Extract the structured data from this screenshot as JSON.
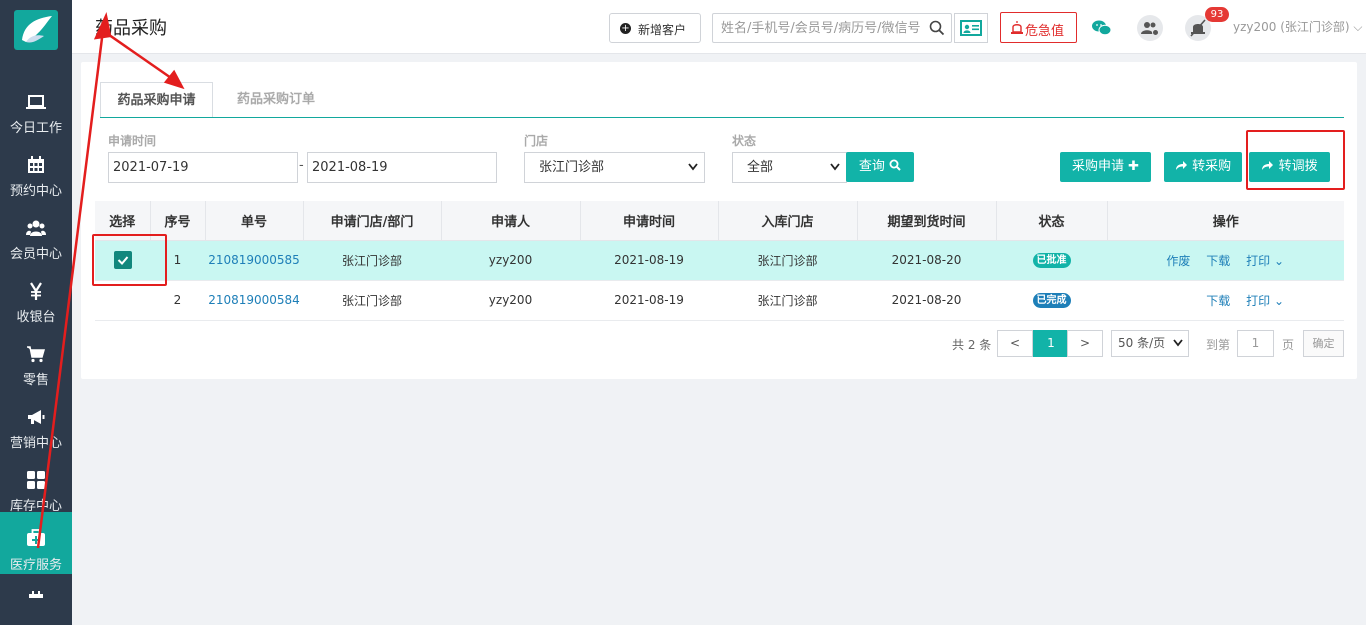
{
  "sidebar": {
    "items": [
      {
        "label": "今日工作",
        "icon": "laptop-icon"
      },
      {
        "label": "预约中心",
        "icon": "calendar-icon"
      },
      {
        "label": "会员中心",
        "icon": "users-icon"
      },
      {
        "label": "收银台",
        "icon": "yen-icon"
      },
      {
        "label": "零售",
        "icon": "cart-icon"
      },
      {
        "label": "营销中心",
        "icon": "megaphone-icon"
      },
      {
        "label": "库存中心",
        "icon": "grid-icon"
      },
      {
        "label": "医疗服务",
        "icon": "medkit-icon"
      }
    ],
    "active": "医疗服务",
    "accent": "#12a89d"
  },
  "header": {
    "title": "药品采购",
    "new_customer": "新增客户",
    "search_placeholder": "姓名/手机号/会员号/病历号/微信号",
    "danger_label": "危急值",
    "badge_count": "93",
    "user": "yzy200 (张江门诊部)"
  },
  "tabs": [
    "药品采购申请",
    "药品采购订单"
  ],
  "filters": {
    "time_label": "申请时间",
    "date_from": "2021-07-19",
    "date_sep": "-",
    "date_to": "2021-08-19",
    "store_label": "门店",
    "store_value": "张江门诊部",
    "status_label": "状态",
    "status_value": "全部",
    "query_label": "查询"
  },
  "actions": {
    "apply": "采购申请",
    "to_purchase": "转采购",
    "to_transfer": "转调拨"
  },
  "table": {
    "headers": [
      "选择",
      "序号",
      "单号",
      "申请门店/部门",
      "申请人",
      "申请时间",
      "入库门店",
      "期望到货时间",
      "状态",
      "操作"
    ],
    "rows": [
      {
        "selected": true,
        "no": "1",
        "order": "210819000585",
        "store": "张江门诊部",
        "applicant": "yzy200",
        "time": "2021-08-19",
        "in_store": "张江门诊部",
        "expected": "2021-08-20",
        "status": "已批准",
        "status_color": "#12b3a8",
        "ops": [
          "作废",
          "下载",
          "打印"
        ]
      },
      {
        "selected": false,
        "no": "2",
        "order": "210819000584",
        "store": "张江门诊部",
        "applicant": "yzy200",
        "time": "2021-08-19",
        "in_store": "张江门诊部",
        "expected": "2021-08-20",
        "status": "已完成",
        "status_color": "#1e7fb8",
        "ops": [
          "下载",
          "打印"
        ]
      }
    ]
  },
  "pagination": {
    "total": "共 2 条",
    "prev": "<",
    "current": "1",
    "next": ">",
    "page_size": "50 条/页",
    "goto": "到第",
    "goto_value": "1",
    "page_unit": "页",
    "confirm": "确定"
  },
  "annotation_color": "#e31e1e"
}
